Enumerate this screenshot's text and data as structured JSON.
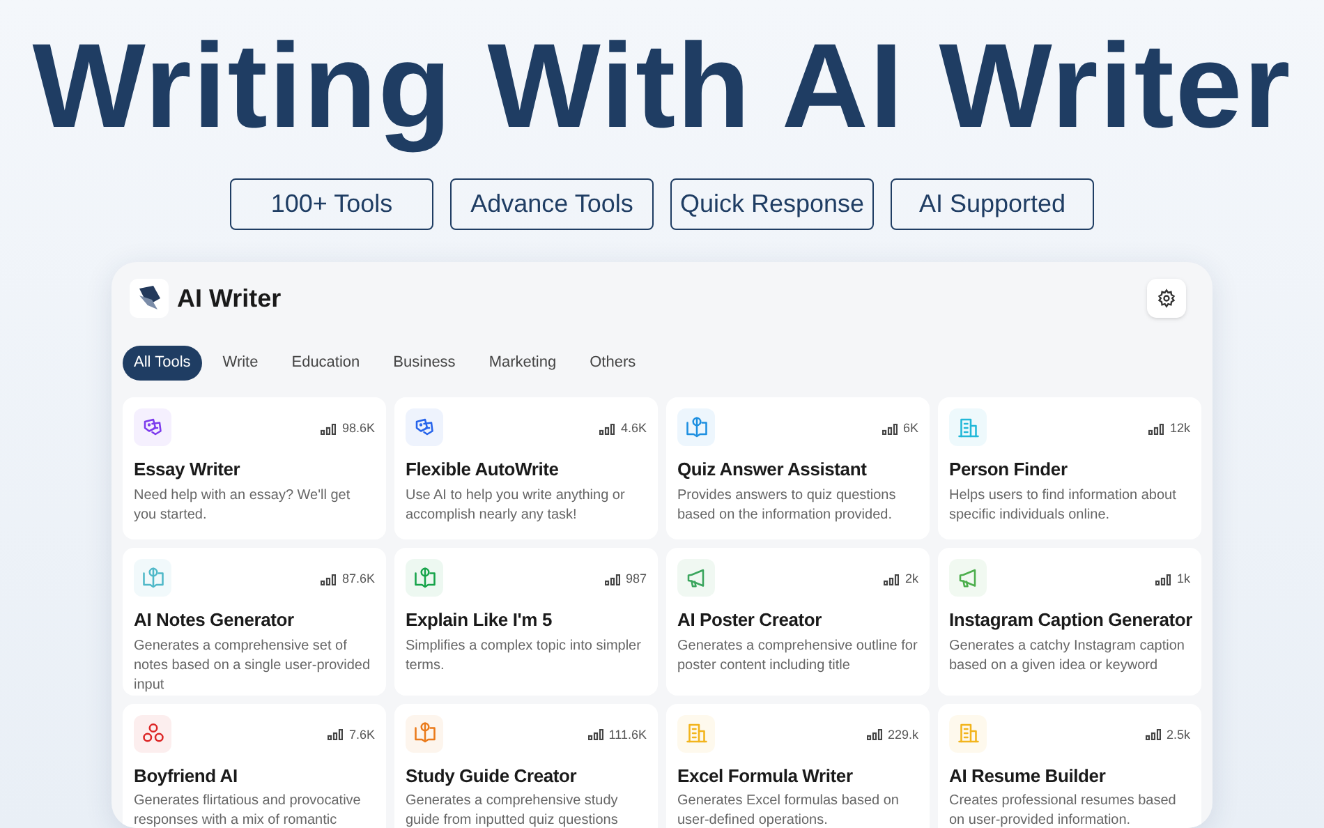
{
  "headline": "Writing With AI Writer",
  "features": [
    "100+ Tools",
    "Advance Tools",
    "Quick Response",
    "AI Supported"
  ],
  "app": {
    "title": "AI Writer"
  },
  "tabs": [
    {
      "label": "All Tools",
      "selected": true
    },
    {
      "label": "Write",
      "selected": false
    },
    {
      "label": "Education",
      "selected": false
    },
    {
      "label": "Business",
      "selected": false
    },
    {
      "label": "Marketing",
      "selected": false
    },
    {
      "label": "Others",
      "selected": false
    }
  ],
  "tools": [
    {
      "title": "Essay Writer",
      "description": "Need help with an essay? We'll get you started.",
      "uses": "98.6K",
      "kind": "masks",
      "color": "#7c3aed"
    },
    {
      "title": "Flexible AutoWrite",
      "description": "Use AI to help you write anything or accomplish nearly any task!",
      "uses": "4.6K",
      "kind": "masks",
      "color": "#2563eb"
    },
    {
      "title": "Quiz Answer Assistant",
      "description": "Provides answers to quiz questions based on the information provided.",
      "uses": "6K",
      "kind": "book",
      "color": "#1d8fe0"
    },
    {
      "title": "Person Finder",
      "description": "Helps users to find information about specific individuals online.",
      "uses": "12k",
      "kind": "building",
      "color": "#22b8d8"
    },
    {
      "title": "AI Notes Generator",
      "description": "Generates a comprehensive set of notes based on a single user-provided input",
      "uses": "87.6K",
      "kind": "book",
      "color": "#4fb8c8"
    },
    {
      "title": "Explain Like I'm 5",
      "description": "Simplifies a complex topic into simpler terms.",
      "uses": "987",
      "kind": "book",
      "color": "#16a34a"
    },
    {
      "title": "AI Poster Creator",
      "description": "Generates a comprehensive outline for poster content including title",
      "uses": "2k",
      "kind": "megaphone",
      "color": "#3aa55d"
    },
    {
      "title": "Instagram Caption Generator",
      "description": "Generates a catchy Instagram caption based on a given idea or keyword",
      "uses": "1k",
      "kind": "megaphone",
      "color": "#4cae4c"
    },
    {
      "title": "Boyfriend AI",
      "description": "Generates flirtatious and provocative responses with a mix of romantic",
      "uses": "7.6K",
      "kind": "circles",
      "color": "#dc2626"
    },
    {
      "title": "Study Guide Creator",
      "description": "Generates a comprehensive study guide from inputted quiz questions",
      "uses": "111.6K",
      "kind": "book",
      "color": "#ea7a1a"
    },
    {
      "title": "Excel Formula Writer",
      "description": "Generates Excel formulas based on user-defined operations.",
      "uses": "229.k",
      "kind": "building",
      "color": "#f2b41c"
    },
    {
      "title": "AI Resume Builder",
      "description": "Creates professional resumes based on user-provided information.",
      "uses": "2.5k",
      "kind": "building",
      "color": "#f2b41c"
    }
  ]
}
